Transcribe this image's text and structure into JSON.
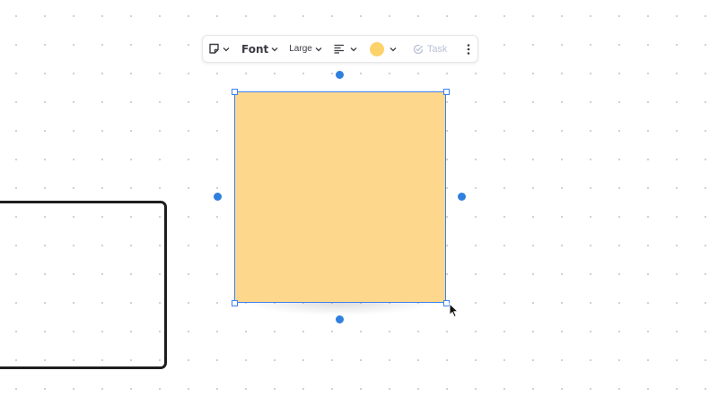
{
  "toolbar": {
    "font_label": "Font",
    "size_label": "Large",
    "task_label": "Task",
    "icons": {
      "note_type": "sticky-note-icon",
      "align": "text-align-left-icon",
      "task": "task-check-icon",
      "more": "more-vertical-icon",
      "chevron": "chevron-down-icon"
    }
  },
  "sticky_note": {
    "text": "",
    "color": "#fdd78c"
  },
  "colors": {
    "accent": "#3b82f6",
    "handle_dot": "#2f7fde",
    "swatch": "#fcd26a",
    "shape_stroke": "#1e1e1e"
  }
}
